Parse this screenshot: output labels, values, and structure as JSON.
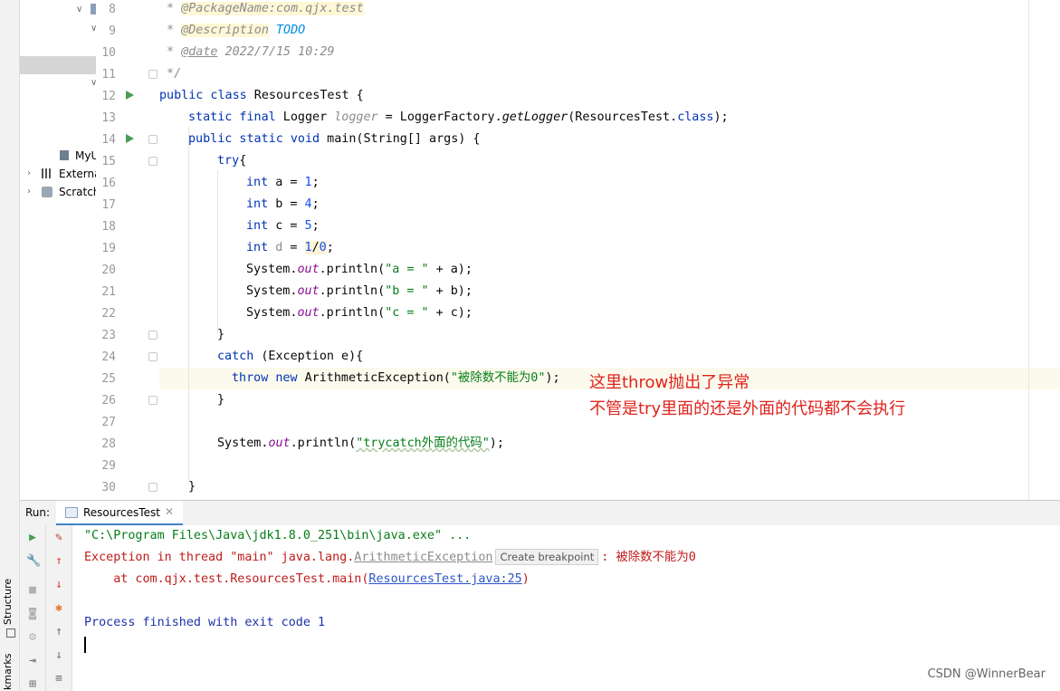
{
  "tool_window": {
    "structure_label": "Structure",
    "bookmarks_label": "kmarks"
  },
  "project_tree": {
    "items": [
      {
        "label": "MyU"
      },
      {
        "label": "Externa"
      },
      {
        "label": "Scratch"
      }
    ]
  },
  "editor": {
    "current_line": 25,
    "lines": [
      {
        "n": "8"
      },
      {
        "n": "9"
      },
      {
        "n": "10"
      },
      {
        "n": "11"
      },
      {
        "n": "12"
      },
      {
        "n": "13"
      },
      {
        "n": "14"
      },
      {
        "n": "15"
      },
      {
        "n": "16"
      },
      {
        "n": "17"
      },
      {
        "n": "18"
      },
      {
        "n": "19"
      },
      {
        "n": "20"
      },
      {
        "n": "21"
      },
      {
        "n": "22"
      },
      {
        "n": "23"
      },
      {
        "n": "24"
      },
      {
        "n": "25"
      },
      {
        "n": "26"
      },
      {
        "n": "27"
      },
      {
        "n": "28"
      },
      {
        "n": "29"
      },
      {
        "n": "30"
      }
    ],
    "code": {
      "l8_star": " * ",
      "l8_tag": "@PackageName:com.qjx.test",
      "l9_star": " * ",
      "l9_tag": "@Description",
      "l9_todo": "TODO",
      "l10_star": " * ",
      "l10_tag": "@date",
      "l10_rest": " 2022/7/15 10:29",
      "l11": " */",
      "l12_kw": "public class",
      "l12_rest": " ResourcesTest {",
      "l13_kw": "static final",
      "l13_type": " Logger ",
      "l13_field": "logger",
      "l13_eq": " = LoggerFactory.",
      "l13_meth": "getLogger",
      "l13_arg": "(ResourcesTest.",
      "l13_class": "class",
      "l13_end": ");",
      "l14_kw": "public static void",
      "l14_rest": " main(String[] args) {",
      "l15_kw": "try",
      "l15_rest": "{",
      "l16_kw": "int",
      "l16_a": " a = ",
      "l16_num": "1",
      "l16_end": ";",
      "l17_kw": "int",
      "l17_a": " b = ",
      "l17_num": "4",
      "l17_end": ";",
      "l18_kw": "int",
      "l18_a": " c = ",
      "l18_num": "5",
      "l18_end": ";",
      "l19_kw": "int",
      "l19_sp": " ",
      "l19_var": "d",
      "l19_eq": " = ",
      "l19_n1": "1",
      "l19_slash": "/",
      "l19_n2": "0",
      "l19_end": ";",
      "l20_sys": "System.",
      "l20_out": "out",
      "l20_pr": ".println(",
      "l20_str": "\"a = \"",
      "l20_end": " + a);",
      "l21_sys": "System.",
      "l21_out": "out",
      "l21_pr": ".println(",
      "l21_str": "\"b = \"",
      "l21_end": " + b);",
      "l22_sys": "System.",
      "l22_out": "out",
      "l22_pr": ".println(",
      "l22_str": "\"c = \"",
      "l22_end": " + c);",
      "l23": "}",
      "l24_kw": "catch",
      "l24_rest": " (Exception e){",
      "l25_kw1": "throw",
      "l25_kw2": "new",
      "l25_rest": " ArithmeticException(",
      "l25_str": "\"被除数不能为0\"",
      "l25_end": ");",
      "l26": "}",
      "l28_sys": "System.",
      "l28_out": "out",
      "l28_pr": ".println(",
      "l28_str": "\"trycatch外面的代码\"",
      "l28_end": ");",
      "l30": "}"
    }
  },
  "annotation": {
    "line1": "这里throw抛出了异常",
    "line2": "不管是try里面的还是外面的代码都不会执行"
  },
  "run_panel": {
    "label": "Run:",
    "tab_label": "ResourcesTest",
    "output": {
      "cmd": "\"C:\\Program Files\\Java\\jdk1.8.0_251\\bin\\java.exe\" ...",
      "ex_prefix": "Exception in thread \"main\" java.lang.",
      "ex_class": "ArithmeticException",
      "ex_tip": "Create breakpoint",
      "ex_msg": ": 被除数不能为0",
      "at_prefix": "    at com.qjx.test.ResourcesTest.main(",
      "at_link": "ResourcesTest.java:25",
      "at_end": ")",
      "finished": "Process finished with exit code 1"
    }
  },
  "watermark": "CSDN @WinnerBear"
}
